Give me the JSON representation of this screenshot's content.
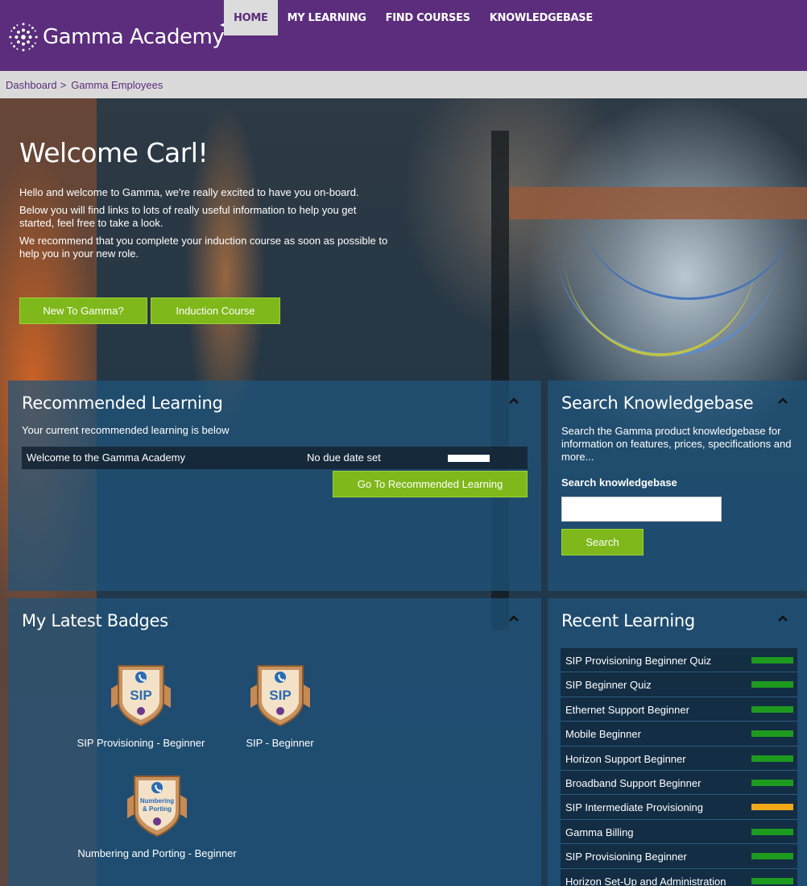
{
  "header": {
    "logo_text": "Gamma Academy",
    "nav": [
      {
        "label": "HOME",
        "active": true
      },
      {
        "label": "MY LEARNING",
        "active": false
      },
      {
        "label": "FIND COURSES",
        "active": false
      },
      {
        "label": "KNOWLEDGEBASE",
        "active": false
      }
    ],
    "colors": {
      "brand": "#5b2d7c",
      "accent": "#7fb81a"
    }
  },
  "breadcrumb": {
    "items": [
      "Dashboard",
      "Gamma Employees"
    ],
    "separator": ">"
  },
  "welcome": {
    "title": "Welcome Carl!",
    "para1": "Hello and welcome to Gamma, we're really excited to have you on-board.",
    "para2": "Below you will find links to lots of really useful information to help you get started, feel free to take a look.",
    "para3": "We recommend that you complete your induction course as soon as possible to help you in your new role.",
    "btn_new": "New To Gamma?",
    "btn_induction": "Induction Course"
  },
  "recommended": {
    "title": "Recommended Learning",
    "subtitle": "Your current recommended learning is below",
    "row": {
      "name": "Welcome to the Gamma Academy",
      "due": "No due date set",
      "progress": 0
    },
    "button": "Go To Recommended Learning",
    "collapse_icon": "chevron-up-icon"
  },
  "knowledgebase": {
    "title": "Search Knowledgebase",
    "description": "Search the Gamma product knowledgebase for information on features, prices, specifications and more...",
    "field_label": "Search knowledgebase",
    "input_value": "",
    "button": "Search"
  },
  "badges": {
    "title": "My Latest Badges",
    "items": [
      {
        "label": "SIP Provisioning - Beginner",
        "emblem": "SIP"
      },
      {
        "label": "SIP - Beginner",
        "emblem": "SIP"
      },
      {
        "label": "Numbering and Porting - Beginner",
        "emblem": "Numbering & Porting"
      }
    ]
  },
  "recent": {
    "title": "Recent Learning",
    "items": [
      {
        "label": "SIP Provisioning Beginner Quiz",
        "status": "complete",
        "color": "#1e9a1e"
      },
      {
        "label": "SIP Beginner Quiz",
        "status": "complete",
        "color": "#1e9a1e"
      },
      {
        "label": "Ethernet Support Beginner",
        "status": "complete",
        "color": "#1e9a1e"
      },
      {
        "label": "Mobile Beginner",
        "status": "complete",
        "color": "#1e9a1e"
      },
      {
        "label": "Horizon Support Beginner",
        "status": "complete",
        "color": "#1e9a1e"
      },
      {
        "label": "Broadband Support Beginner",
        "status": "complete",
        "color": "#1e9a1e"
      },
      {
        "label": "SIP Intermediate Provisioning",
        "status": "in-progress",
        "color": "#f0a818"
      },
      {
        "label": "Gamma Billing",
        "status": "complete",
        "color": "#1e9a1e"
      },
      {
        "label": "SIP Provisioning Beginner",
        "status": "complete",
        "color": "#1e9a1e"
      },
      {
        "label": "Horizon Set-Up and Administration",
        "status": "complete",
        "color": "#1e9a1e"
      }
    ]
  }
}
